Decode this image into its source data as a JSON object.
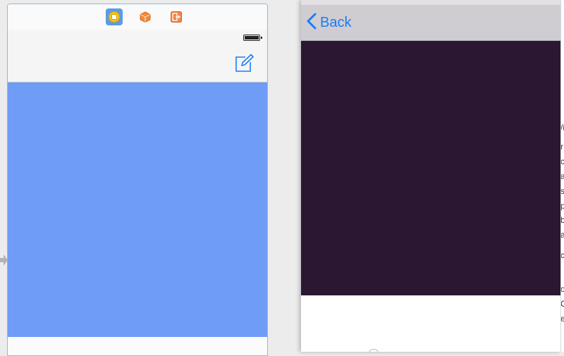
{
  "interface_builder": {
    "scene_dock": {
      "items": [
        {
          "icon": "view-controller-icon",
          "selected": true
        },
        {
          "icon": "first-responder-icon",
          "selected": false
        },
        {
          "icon": "exit-icon",
          "selected": false
        }
      ]
    },
    "status_bar": {
      "icon": "battery-icon"
    },
    "nav_bar": {
      "right_button_icon": "compose-icon"
    },
    "content_view": {
      "color": "#6f9cf7"
    },
    "entry_point": {
      "icon": "entry-arrow-icon"
    }
  },
  "simulator": {
    "nav_bar": {
      "back_label": "Back",
      "back_icon": "chevron-left-icon",
      "tint_color": "#1a7cf5",
      "background": "#d0cdd2"
    },
    "content": {
      "color": "#2b1731"
    }
  },
  "side_panel": {
    "partial_chars": [
      "/i",
      "r",
      "c",
      "a",
      "s",
      "p",
      "b",
      "a",
      "c",
      "o",
      "C",
      "e"
    ]
  }
}
